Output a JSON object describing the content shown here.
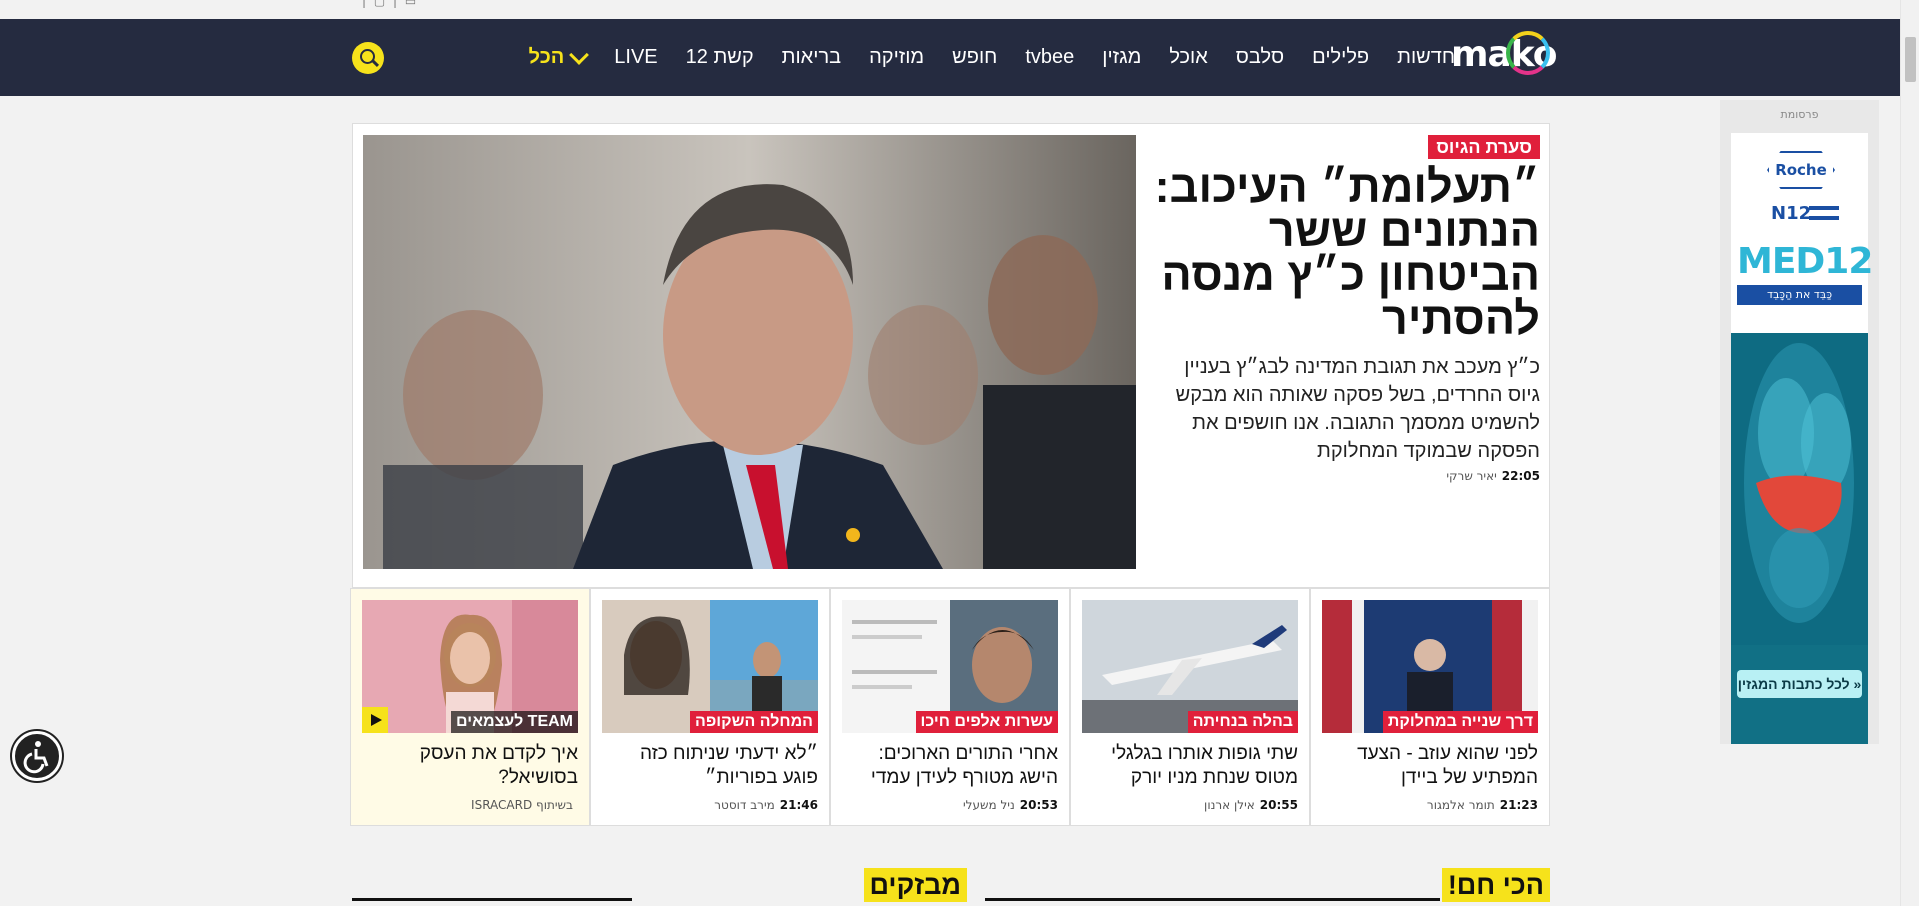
{
  "topstrip": {
    "fragment": "|  ▢  |  ▭"
  },
  "header": {
    "logo": "mako",
    "nav": [
      "חדשות",
      "פלילים",
      "סלבס",
      "אוכל",
      "מגזין",
      "tvbee",
      "חופש",
      "מוזיקה",
      "בריאות",
      "קשת 12",
      "LIVE"
    ],
    "all_label": "הכל",
    "colors": {
      "navbar": "#252b40",
      "accent": "#f6e21b"
    }
  },
  "hero": {
    "tag": "סערת הגיוס",
    "headline": "״תעלומת״ העיכוב: הנתונים ששר הביטחון כ״ץ מנסה להסתיר",
    "lead": "כ״ץ מעכב את תגובת המדינה לבג״ץ בעניין גיוס החרדים, בשל פסקה שאותה הוא מבקש להשמיט ממסמך התגובה. אנו חושפים את הפסקה שבמוקד המחלוקת",
    "time": "22:05",
    "author": "יאיר שרקי"
  },
  "cards": [
    {
      "tag": "דרך שנייה במחלוקת",
      "title": "לפני שהוא עוזב - הצעד המפתיע של ביידן",
      "time": "21:23",
      "author": "תומר אלמגור"
    },
    {
      "tag": "בהלה בנחיתה",
      "title": "שתי גופות אותרו בגלגלי מטוס שנחת מניו יורק",
      "time": "20:55",
      "author": "אילן ארנון"
    },
    {
      "tag": "עשרות אלפים חיכו",
      "title": "אחרי התורים הארוכים: הישג מטורף לעידן עמדי",
      "time": "20:53",
      "author": "ניל משעלי"
    },
    {
      "tag": "המחלה השקופה",
      "title": "״לא ידעתי שניתוח כזה פוגע בפוריות״",
      "time": "21:46",
      "author": "מירב דוסטר"
    },
    {
      "tag": "TEAM לעצמאים",
      "title": "איך לקדם את העסק בסושיאל?",
      "time": "",
      "author": "בשיתוף ISRACARD"
    }
  ],
  "ad": {
    "label": "פרסומת",
    "brand": "Roche",
    "partner": "N12",
    "product": "MED12",
    "tagline": "כַּבֵּד את הַכָּבֵד",
    "cta": "לכל כתבות המגזין »"
  },
  "sections": {
    "hot": "הכי חם!",
    "breaking": "מבזקים"
  }
}
